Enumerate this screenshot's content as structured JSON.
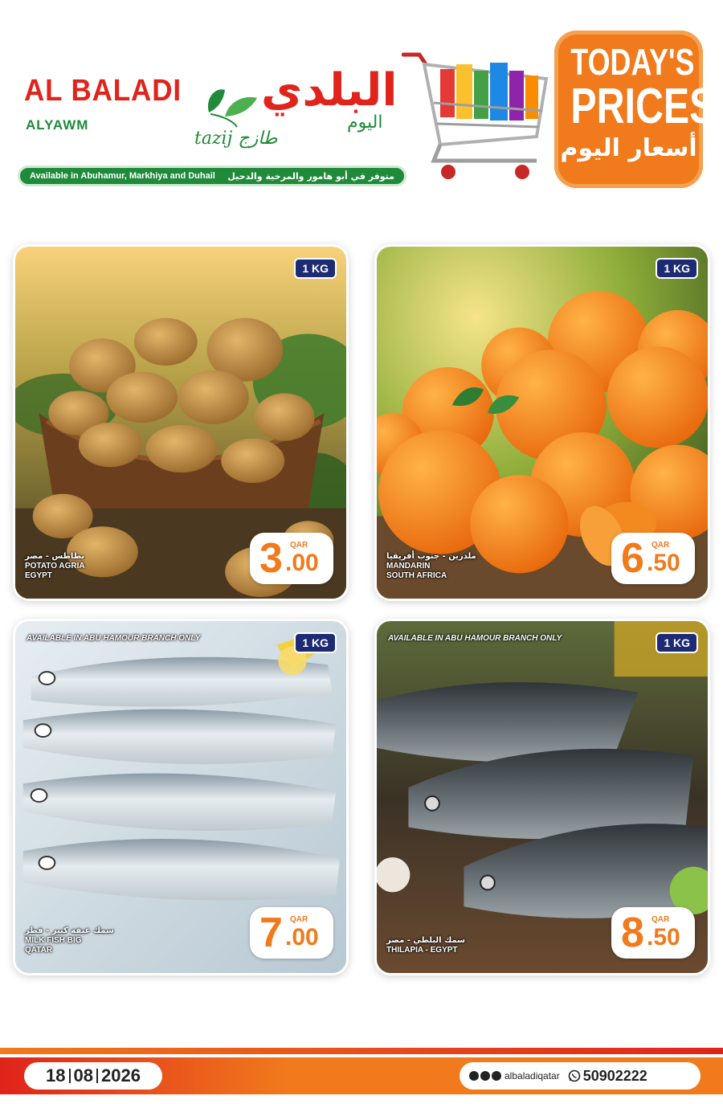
{
  "brand": {
    "name_en": "AL BALADI",
    "sub_en": "ALYAWM",
    "name_ar": "البلدي",
    "sub_ar": "اليوم",
    "tazij": "tazij طازج",
    "availability_en": "Available in Abuhamur, Markhiya and Duhail",
    "availability_ar": "متوفر في أبو هامور والمرخية والدحيل"
  },
  "badge": {
    "line1": "TODAY'S",
    "line2": "PRICES",
    "line_ar": "أسعار اليوم"
  },
  "products": [
    {
      "weight": "1 KG",
      "name_ar": "بطاطس - مصر",
      "name_en": "POTATO AGRIA",
      "origin": "EGYPT",
      "currency": "QAR",
      "price_whole": "3",
      "price_decimal": ".00"
    },
    {
      "weight": "1 KG",
      "name_ar": "ملدرين - جنوب أفريقيا",
      "name_en": "MANDARIN",
      "origin": "SOUTH AFRICA",
      "currency": "QAR",
      "price_whole": "6",
      "price_decimal": ".50"
    },
    {
      "weight": "1 KG",
      "note": "AVAILABLE IN ABU HAMOUR BRANCH ONLY",
      "name_ar": "سمك عيفة كبير - قطر",
      "name_en": "MILK FISH BIG",
      "origin": "QATAR",
      "currency": "QAR",
      "price_whole": "7",
      "price_decimal": ".00"
    },
    {
      "weight": "1 KG",
      "note": "AVAILABLE IN ABU HAMOUR BRANCH ONLY",
      "name_ar": "سمك البلطي - مصر",
      "name_en": "THILAPIA - EGYPT",
      "origin": "",
      "currency": "QAR",
      "price_whole": "8",
      "price_decimal": ".50"
    }
  ],
  "footer": {
    "date_day": "18",
    "date_month": "08",
    "date_year": "2026",
    "handle": "albaladiqatar",
    "phone": "50902222"
  },
  "colors": {
    "brand_red": "#e0231b",
    "brand_green": "#1f8a3a",
    "accent_orange": "#f07a1c",
    "badge_navy": "#1d2b73"
  }
}
